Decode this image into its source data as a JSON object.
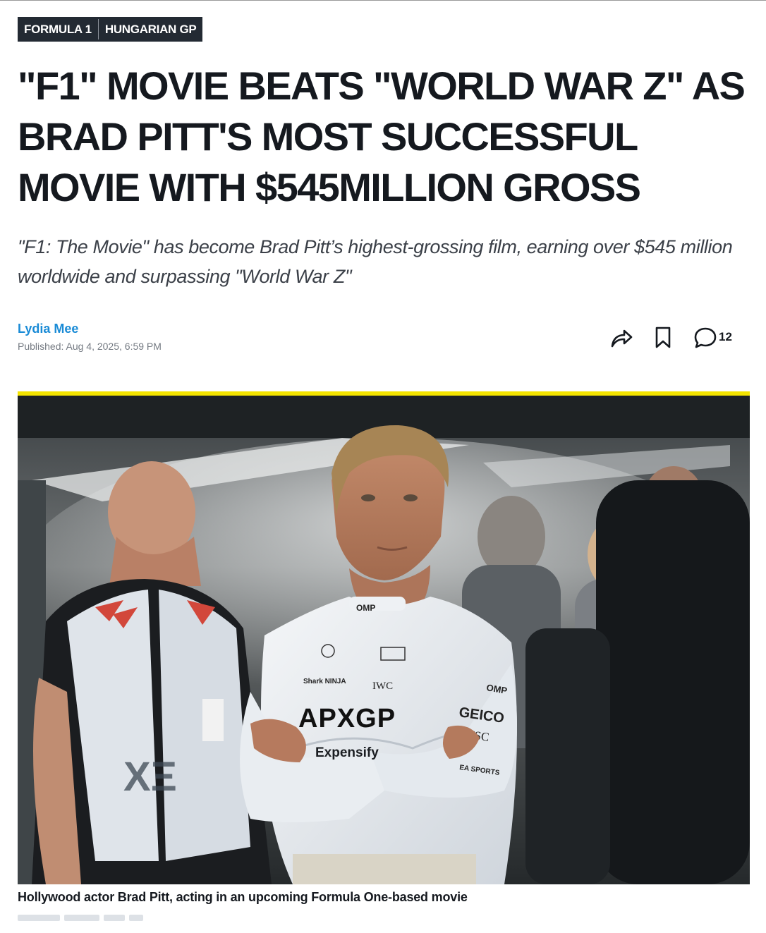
{
  "breadcrumb": [
    {
      "label": "FORMULA 1"
    },
    {
      "label": "HUNGARIAN GP"
    }
  ],
  "article": {
    "headline": "\"F1\" MOVIE BEATS \"WORLD WAR Z\" AS BRAD PITT'S MOST SUCCESSFUL MOVIE WITH $545MILLION GROSS",
    "subheadline": "\"F1: The Movie\" has become Brad Pitt’s highest-grossing film, earning over $545 million worldwide and surpassing \"World War Z\"",
    "author": "Lydia Mee",
    "published": "Published: Aug 4, 2025, 6:59 PM",
    "comment_count": "12",
    "image_caption": "Hollywood actor Brad Pitt, acting in an upcoming Formula One-based movie"
  },
  "icons": {
    "share": "share-icon",
    "bookmark": "bookmark-icon",
    "comment": "comment-icon"
  },
  "colors": {
    "accent_yellow": "#f4e400",
    "author_blue": "#1a8bd6",
    "breadcrumb_bg": "#232a33"
  },
  "photo": {
    "suit_branding": [
      "OMP",
      "Shark NINJA",
      "IWC",
      "OMP",
      "GEICO",
      "MSC",
      "Expensify",
      "EA SPORTS"
    ],
    "suit_logo": "APXGP"
  }
}
